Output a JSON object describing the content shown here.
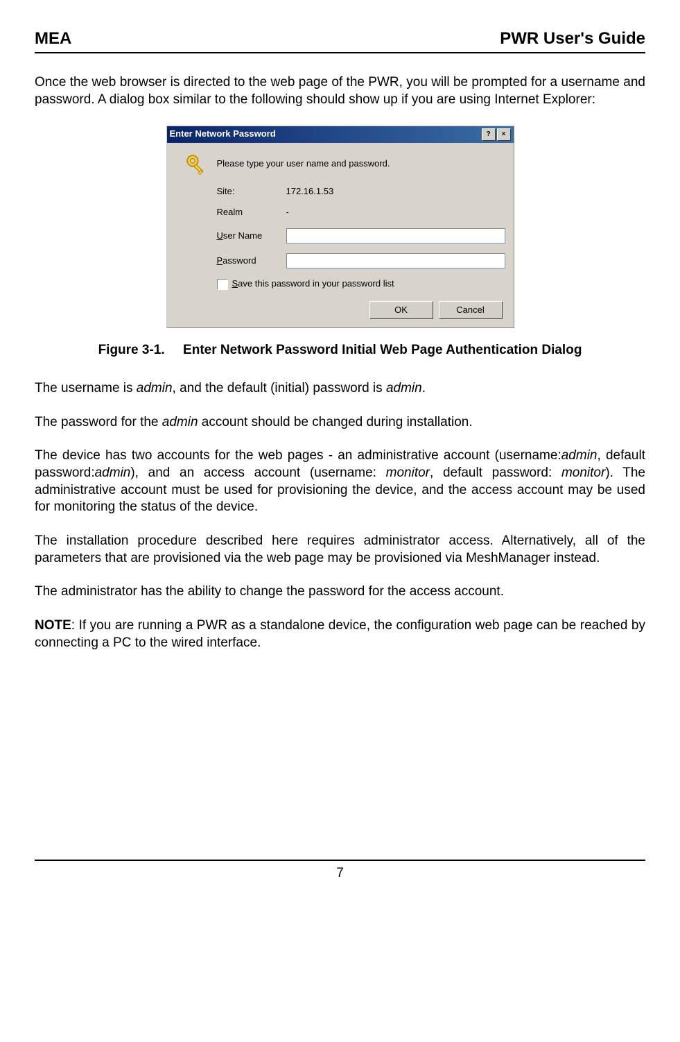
{
  "header": {
    "left": "MEA",
    "right": "PWR User's Guide"
  },
  "intro": "Once the web browser is directed to the web page of the PWR, you will be prompted for a username and password. A dialog box similar to the following should show up if you are using Internet Explorer:",
  "dialog": {
    "title": "Enter Network Password",
    "help_btn": "?",
    "close_btn": "×",
    "prompt": "Please type your user name and password.",
    "site_label": "Site:",
    "site_value": "172.16.1.53",
    "realm_label": "Realm",
    "realm_value": "-",
    "user_label": "User Name",
    "pass_label": "Password",
    "save_label": "Save this password in your password list",
    "ok": "OK",
    "cancel": "Cancel"
  },
  "caption_prefix": "Figure 3-1.",
  "caption_text": "Enter Network Password Initial Web Page Authentication Dialog",
  "p_username_1": "The username is ",
  "p_username_2": "admin",
  "p_username_3": ", and the default (initial) password is ",
  "p_username_4": "admin",
  "p_username_5": ".",
  "p_pw_1": "The password for the ",
  "p_pw_2": "admin",
  "p_pw_3": " account should be changed during installation.",
  "p_accounts_1": "The device has two accounts for the web pages - an administrative account (username:",
  "p_accounts_2": "admin",
  "p_accounts_3": ", default password:",
  "p_accounts_4": "admin",
  "p_accounts_5": "), and an access account (username: ",
  "p_accounts_6": "monitor",
  "p_accounts_7": ", default password: ",
  "p_accounts_8": "monitor",
  "p_accounts_9": "). The administrative account must be used for provisioning the device, and the access account may be used for monitoring the status of the device.",
  "p_install": "The installation procedure described here requires administrator access. Alternatively, all of the parameters that are provisioned via the web page may be provisioned via MeshManager instead.",
  "p_admin": "The administrator has the ability to change the password for the access account.",
  "p_note_label": "NOTE",
  "p_note_text": ": If you are running a PWR as a standalone device, the configuration web page can be reached by connecting a PC to the wired interface.",
  "page_number": "7"
}
